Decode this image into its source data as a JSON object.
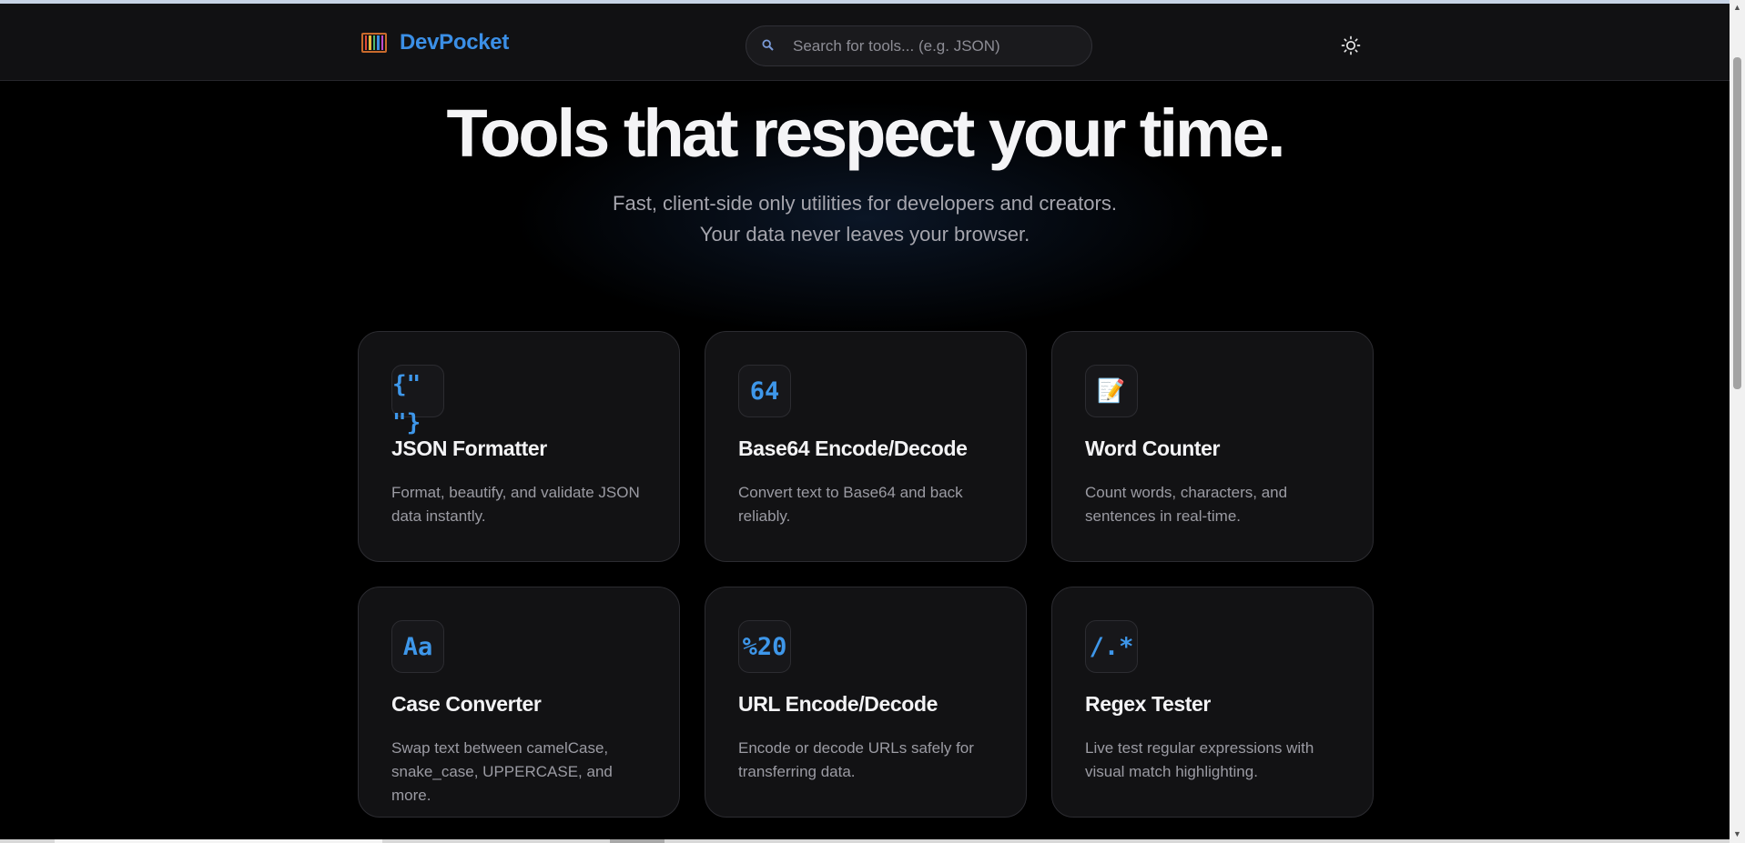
{
  "header": {
    "logo_text": "DevPocket",
    "search_placeholder": "Search for tools... (e.g. JSON)",
    "search_icon": "magnifier-icon",
    "theme_icon": "sun-icon"
  },
  "hero": {
    "title": "Tools that respect your time.",
    "subtitle_line1": "Fast, client-side only utilities for developers and creators.",
    "subtitle_line2": "Your data never leaves your browser."
  },
  "tools": [
    {
      "icon": "{\"\n\"}",
      "title": "JSON Formatter",
      "description": "Format, beautify, and validate JSON data instantly."
    },
    {
      "icon": "64",
      "title": "Base64 Encode/Decode",
      "description": "Convert text to Base64 and back reliably."
    },
    {
      "icon": "📝",
      "title": "Word Counter",
      "description": "Count words, characters, and sentences in real-time."
    },
    {
      "icon": "Aa",
      "title": "Case Converter",
      "description": "Swap text between camelCase, snake_case, UPPERCASE, and more."
    },
    {
      "icon": "%20",
      "title": "URL Encode/Decode",
      "description": "Encode or decode URLs safely for transferring data."
    },
    {
      "icon": "/.*",
      "title": "Regex Tester",
      "description": "Live test regular expressions with visual match highlighting."
    }
  ],
  "colors": {
    "accent": "#3b8fe6",
    "background": "#000000",
    "card": "#121214"
  }
}
